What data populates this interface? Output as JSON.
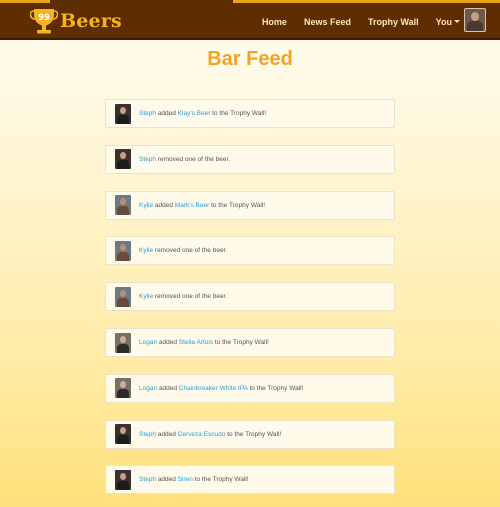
{
  "brand": {
    "logo_number": "99",
    "name": "Beers"
  },
  "nav": {
    "home": "Home",
    "news_feed": "News Feed",
    "trophy_wall": "Trophy Wall",
    "you": "You"
  },
  "page": {
    "title": "Bar Feed"
  },
  "feed": [
    {
      "user": "Steph",
      "pre": "added",
      "beer": "Klay's Beer",
      "post": "to the Trophy Wall!"
    },
    {
      "user": "Steph",
      "pre": "removed one of the beer.",
      "beer": "",
      "post": ""
    },
    {
      "user": "Kylie",
      "pre": "added",
      "beer": "Mark's Beer",
      "post": "to the Trophy Wall!"
    },
    {
      "user": "Kylie",
      "pre": "removed one of the beer.",
      "beer": "",
      "post": ""
    },
    {
      "user": "Kylie",
      "pre": "removed one of the beer.",
      "beer": "",
      "post": ""
    },
    {
      "user": "Logan",
      "pre": "added",
      "beer": "Stella Artois",
      "post": "to the Trophy Wall!"
    },
    {
      "user": "Logan",
      "pre": "added",
      "beer": "Chainbreaker White IPA",
      "post": "to the Trophy Wall!"
    },
    {
      "user": "Steph",
      "pre": "added",
      "beer": "Cerveza Escudo",
      "post": "to the Trophy Wall!"
    },
    {
      "user": "Steph",
      "pre": "added",
      "beer": "Siren",
      "post": "to the Trophy Wall!"
    }
  ],
  "colors": {
    "navbar": "#5f2d02",
    "brand": "#f5b51e",
    "title": "#f0a327",
    "link": "#2a9fd6"
  }
}
